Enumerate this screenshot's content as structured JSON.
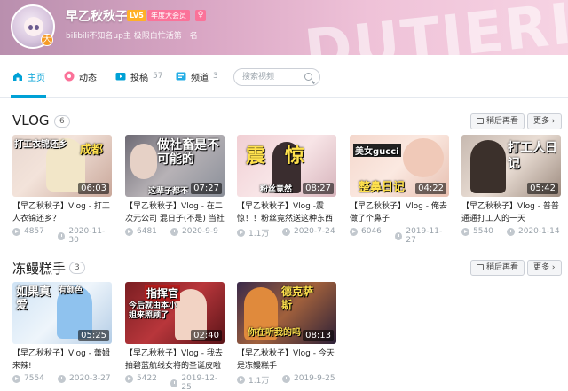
{
  "header": {
    "banner_art_text": "DUTIERI",
    "username": "早乙秋秋子",
    "level": "LV5",
    "vip": "年度大会员",
    "gender_symbol": "♀",
    "signature": "bilibili不知名up主 极限白忙活第一名",
    "avatar_badge_symbol": "大"
  },
  "nav": {
    "items": [
      {
        "label": "主页",
        "count": "",
        "icon": "home-icon",
        "active": true
      },
      {
        "label": "动态",
        "count": "",
        "icon": "dynamic-icon"
      },
      {
        "label": "投稿",
        "count": "57",
        "icon": "upload-icon"
      },
      {
        "label": "频道",
        "count": "3",
        "icon": "channel-icon"
      }
    ],
    "search_placeholder": "搜索视频"
  },
  "sections": [
    {
      "title": "VLOG",
      "count": "6",
      "watch_later": "稍后再看",
      "more": "更多",
      "videos": [
        {
          "thumb_text": "成都",
          "thumb_text2": "打工衣锦还乡",
          "duration": "06:03",
          "title": "【早乙秋秋子】Vlog - 打工人衣锦还乡？",
          "views": "4857",
          "date": "2020-11-30"
        },
        {
          "thumb_text": "做社畜是不可能的",
          "thumb_text2": "这辈子都不",
          "duration": "07:27",
          "title": "【早乙秋秋子】Vlog - 在二次元公司 混日子(不是) 当社畜",
          "views": "6481",
          "date": "2020-9-9"
        },
        {
          "thumb_text": "震惊",
          "thumb_text2": "粉丝竟然",
          "duration": "08:27",
          "title": "【早乙秋秋子】Vlog -震惊！！粉丝竟然送这种东西 女",
          "views": "1.1万",
          "date": "2020-7-24"
        },
        {
          "thumb_text": "整鼻日记",
          "thumb_text2": "美女gucci",
          "duration": "04:22",
          "title": "【早乙秋秋子】Vlog - 俺去做了个鼻子",
          "views": "6046",
          "date": "2019-11-27"
        },
        {
          "thumb_text": "打工人日记",
          "thumb_text2": "",
          "duration": "05:42",
          "title": "【早乙秋秋子】Vlog - 普普通通打工人的一天",
          "views": "5540",
          "date": "2020-1-14"
        }
      ]
    },
    {
      "title": "冻鳗糕手",
      "count": "3",
      "watch_later": "稍后再看",
      "more": "更多",
      "videos": [
        {
          "thumb_text": "如果真爱",
          "thumb_text2": "有颜色",
          "duration": "05:25",
          "title": "【早乙秋秋子】Vlog - 蕾姆来辣!",
          "views": "7554",
          "date": "2020-3-27"
        },
        {
          "thumb_text": "指挥官",
          "thumb_text2": "今后就由本小姐来照顾了",
          "duration": "02:40",
          "title": "【早乙秋秋子】Vlog - 我去拍碧蓝航线女将的圣诞皮啦",
          "views": "5422",
          "date": "2019-12-25"
        },
        {
          "thumb_text": "德克萨斯",
          "thumb_text2": "你在听我的吗",
          "duration": "08:13",
          "title": "【早乙秋秋子】Vlog - 今天是冻鳗糕手",
          "views": "1.1万",
          "date": "2019-9-25"
        }
      ]
    }
  ],
  "colors": {
    "accent": "#00a1d6",
    "pink": "#fb7299",
    "meta": "#99a2aa"
  }
}
